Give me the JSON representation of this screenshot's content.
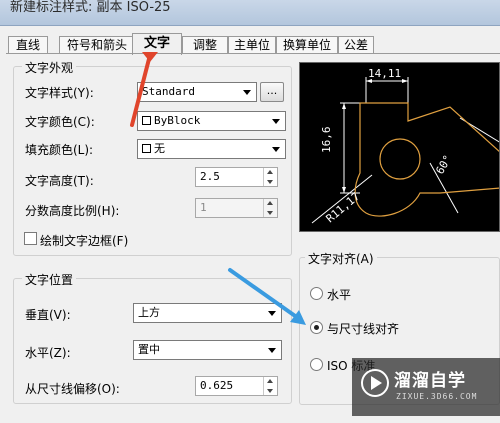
{
  "window": {
    "title": "新建标注样式: 副本 ISO-25"
  },
  "tabs": [
    {
      "label": "直线"
    },
    {
      "label": "符号和箭头"
    },
    {
      "label": "文字"
    },
    {
      "label": "调整"
    },
    {
      "label": "主单位"
    },
    {
      "label": "换算单位"
    },
    {
      "label": "公差"
    }
  ],
  "active_tab": "文字",
  "appearance": {
    "title": "文字外观",
    "style_label": "文字样式(Y):",
    "style_value": "Standard",
    "style_button": "...",
    "color_label": "文字颜色(C):",
    "color_value": "ByBlock",
    "fill_label": "填充颜色(L):",
    "fill_value": "无",
    "height_label": "文字高度(T):",
    "height_value": "2.5",
    "fraction_label": "分数高度比例(H):",
    "fraction_value": "1",
    "frame_label": "绘制文字边框(F)"
  },
  "placement": {
    "title": "文字位置",
    "vertical_label": "垂直(V):",
    "vertical_value": "上方",
    "horizontal_label": "水平(Z):",
    "horizontal_value": "置中",
    "offset_label": "从尺寸线偏移(O):",
    "offset_value": "0.625"
  },
  "alignment": {
    "title": "文字对齐(A)",
    "options": [
      "水平",
      "与尺寸线对齐",
      "ISO 标准"
    ],
    "selected": "与尺寸线对齐"
  },
  "preview": {
    "dim_top": "14,11",
    "dim_left": "16,6",
    "dim_radius": "R11,17",
    "dim_angle": "60°"
  },
  "watermark": {
    "text": "溜溜自学",
    "sub": "ZIXUE.3D66.COM"
  },
  "colors": {
    "accent_arrow": "#e0452c",
    "blue_arrow": "#3a9be0",
    "preview_line": "#ffffff",
    "preview_shape": "#e0a040"
  }
}
